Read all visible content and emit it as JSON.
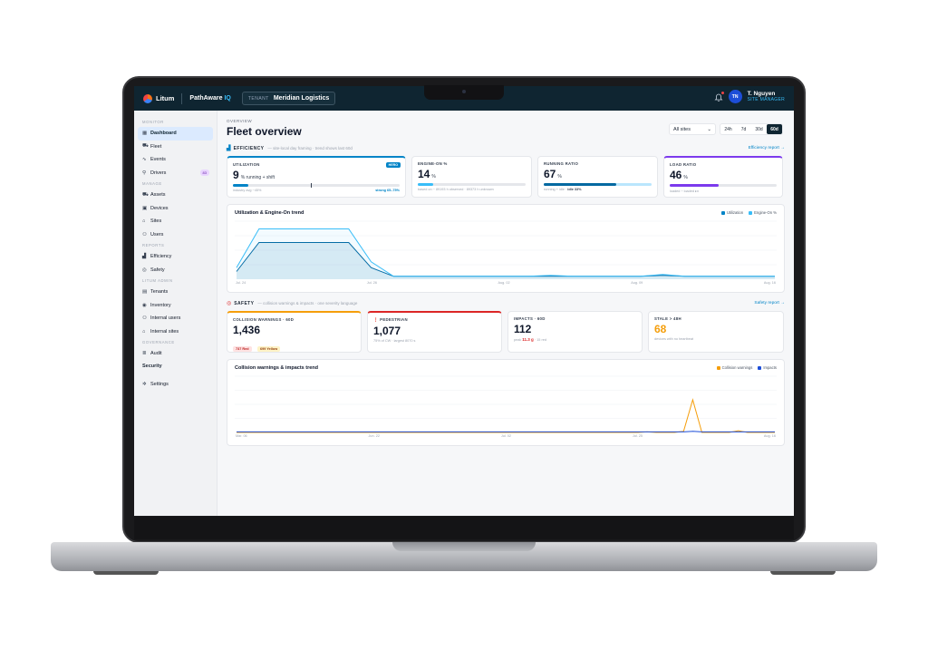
{
  "topbar": {
    "brand": "Litum",
    "product_name": "PathAware",
    "product_suffix": "IQ",
    "tenant_label": "TENANT",
    "tenant_value": "Meridian Logistics",
    "user_initials": "TN",
    "user_name": "T. Nguyen",
    "user_role": "SITE MANAGER"
  },
  "sidebar": {
    "sections": {
      "monitor": "MONITOR",
      "manage": "MANAGE",
      "reports": "REPORTS",
      "litum_admin": "LITUM ADMIN",
      "governance": "GOVERNANCE"
    },
    "items": {
      "dashboard": "Dashboard",
      "fleet": "Fleet",
      "events": "Events",
      "drivers": "Drivers",
      "drivers_badge": "83",
      "assets": "Assets",
      "devices": "Devices",
      "sites": "Sites",
      "users": "Users",
      "efficiency": "Efficiency",
      "safety": "Safety",
      "tenants": "Tenants",
      "inventory": "Inventory",
      "internal_users": "Internal users",
      "internal_sites": "Internal sites",
      "audit": "Audit",
      "security": "Security",
      "settings": "Settings"
    }
  },
  "header": {
    "breadcrumb": "OVERVIEW",
    "title": "Fleet overview",
    "site_filter": "All sites",
    "ranges": [
      "24h",
      "7d",
      "30d",
      "60d"
    ],
    "active_range": "60d"
  },
  "efficiency": {
    "title": "EFFICIENCY",
    "subtitle": "— site-local day framing · trend shows last 60d",
    "link": "Efficiency report →",
    "cards": {
      "utilization": {
        "label": "UTILIZATION",
        "badge": "HERO",
        "value": "9",
        "unit": "% running + shift",
        "note_left": "industry avg ~45%",
        "note_right": "strong 65–75%",
        "fraction": 0.09
      },
      "engine_on": {
        "label": "ENGINE-ON %",
        "value": "14",
        "unit": "%",
        "note": "based on ~ 89193 h observed · 89373 h unknown",
        "fraction": 0.14
      },
      "running_ratio": {
        "label": "RUNNING RATIO",
        "value": "67",
        "unit": "%",
        "note_prefix": "running + idle ·",
        "note_bold": "idle 33%",
        "fraction": 0.67
      },
      "load_ratio": {
        "label": "LOAD RATIO",
        "value": "46",
        "unit": "%",
        "note": "loaded ÷ loaded ▸n",
        "fraction": 0.46
      }
    },
    "colors": {
      "utilization": "#0284c7",
      "engine_on": "#38bdf8",
      "load": "#7c3aed"
    }
  },
  "utilization_chart": {
    "title": "Utilization & Engine-On trend",
    "legend": [
      "Utilization",
      "Engine-On %"
    ],
    "x_labels": [
      "Jul. 24",
      "Jul. 26",
      "Aug. 02",
      "Aug. 09",
      "Aug. 16"
    ]
  },
  "safety": {
    "title": "SAFETY",
    "subtitle": "— collision warnings & impacts · one severity language",
    "link": "Safety report →",
    "cards": {
      "collision": {
        "label": "COLLISION WARNINGS · 60D",
        "value": "1,436",
        "pill_red": "737 Red",
        "pill_yellow": "699 Yellow"
      },
      "pedestrian": {
        "label": "PEDESTRIAN",
        "value": "1,077",
        "note": "75% of CW · largest 8070 s"
      },
      "impacts": {
        "label": "IMPACTS · 60D",
        "value": "112",
        "note_prefix": "peak",
        "note_peak": "11.3 g",
        "note_suffix": "· 15 red"
      },
      "stale": {
        "label": "STALE > 48H",
        "value": "68",
        "note": "devices with no heartbeat"
      }
    }
  },
  "collision_chart": {
    "title": "Collision warnings & impacts trend",
    "legend": [
      "Collision warnings",
      "Impacts"
    ],
    "x_labels": [
      "Mar. 06",
      "Jun. 22",
      "Jul. 02",
      "Jul. 25",
      "Aug. 16"
    ]
  },
  "chart_data": [
    {
      "type": "area",
      "title": "Utilization & Engine-On trend",
      "series": [
        {
          "name": "Utilization",
          "values": [
            8,
            38,
            38,
            38,
            38,
            38,
            12,
            3,
            3,
            3,
            3,
            3,
            3,
            3,
            3,
            3,
            3,
            3,
            3,
            4,
            3,
            3,
            3,
            3,
            3
          ]
        },
        {
          "name": "Engine-On %",
          "values": [
            12,
            52,
            52,
            52,
            52,
            52,
            18,
            3,
            3,
            3,
            3,
            3,
            3,
            3,
            4,
            3,
            3,
            3,
            3,
            5,
            3,
            3,
            3,
            3,
            3
          ]
        }
      ],
      "ylim": [
        0,
        60
      ]
    },
    {
      "type": "line",
      "title": "Collision warnings & impacts trend",
      "series": [
        {
          "name": "Collision warnings",
          "values": [
            0,
            0,
            0,
            0,
            0,
            0,
            0,
            0,
            0,
            0,
            0,
            0,
            0,
            0,
            0,
            0,
            0,
            0,
            0,
            0,
            0,
            0,
            0,
            0,
            0,
            0,
            0,
            0,
            0,
            0,
            0,
            0,
            0,
            0,
            0,
            0,
            0,
            0,
            0,
            0,
            0,
            0,
            0,
            0,
            0,
            1,
            0,
            0,
            0,
            2,
            58,
            0,
            0,
            0,
            0,
            3,
            0,
            0,
            0,
            0
          ]
        },
        {
          "name": "Impacts",
          "values": [
            1,
            1,
            1,
            1,
            1,
            1,
            1,
            1,
            1,
            1,
            1,
            1,
            1,
            1,
            1,
            1,
            1,
            1,
            1,
            1,
            1,
            1,
            1,
            1,
            1,
            1,
            1,
            1,
            1,
            1,
            1,
            1,
            1,
            1,
            1,
            1,
            1,
            1,
            1,
            1,
            1,
            1,
            1,
            1,
            1,
            1,
            1,
            1,
            1,
            1,
            2,
            1,
            1,
            1,
            1,
            1,
            1,
            1,
            1,
            1
          ]
        }
      ],
      "ylim": [
        0,
        100
      ]
    }
  ]
}
